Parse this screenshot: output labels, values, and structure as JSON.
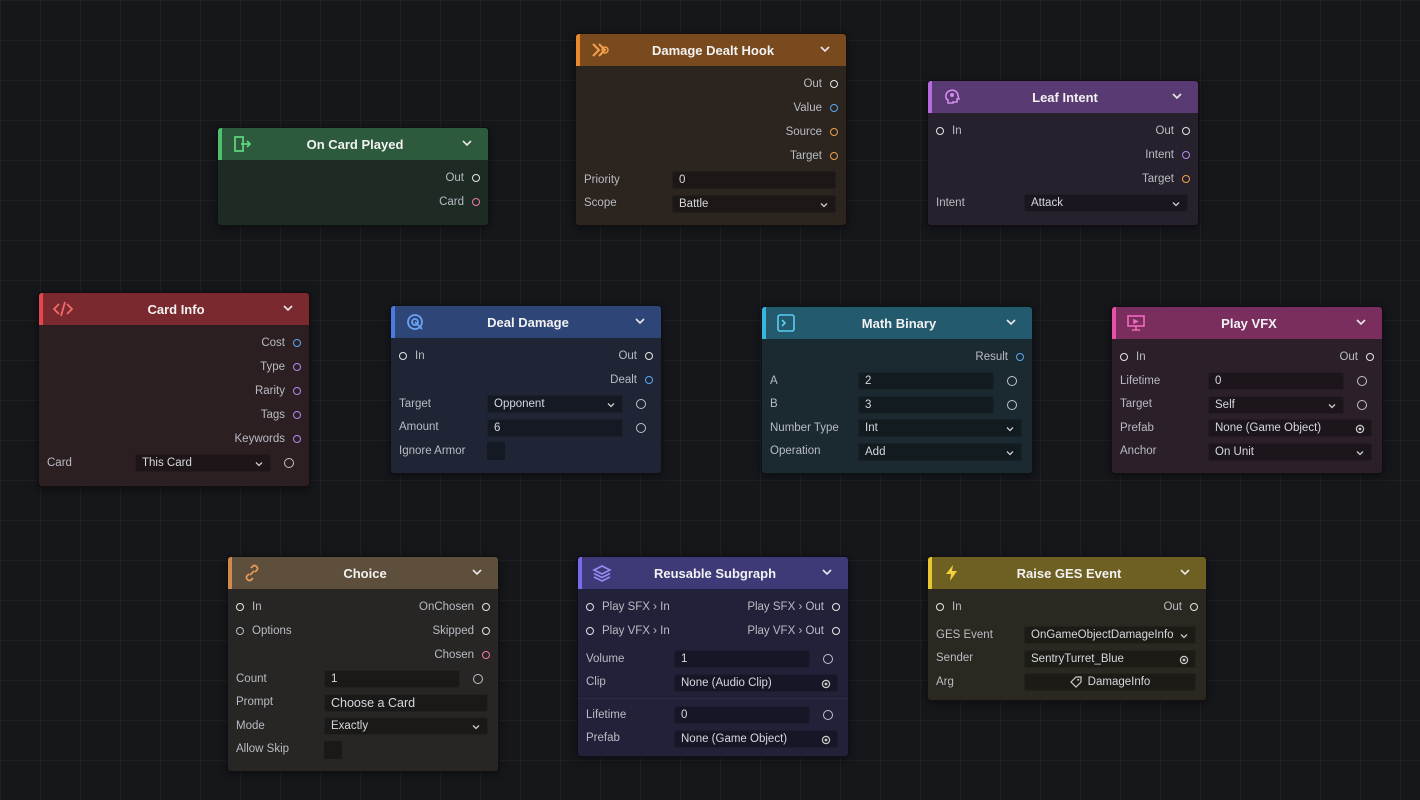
{
  "colors": {
    "canvas": "#15171b",
    "port_white": "#e6e6e6",
    "port_blue": "#5aa7f0",
    "port_purple": "#b58cf0",
    "port_orange": "#f0a04b",
    "port_pink": "#f07aa8"
  },
  "nodes": {
    "damage_hook": {
      "title": "Damage Dealt Hook",
      "icon": "hook-icon",
      "outputs": [
        "Out",
        "Value",
        "Source",
        "Target"
      ],
      "priority_label": "Priority",
      "priority_value": "0",
      "scope_label": "Scope",
      "scope_value": "Battle"
    },
    "leaf_intent": {
      "title": "Leaf Intent",
      "icon": "brain-icon",
      "in_label": "In",
      "outputs": [
        "Out",
        "Intent",
        "Target"
      ],
      "intent_label": "Intent",
      "intent_value": "Attack"
    },
    "card_played": {
      "title": "On Card Played",
      "icon": "exit-door-icon",
      "outputs": [
        "Out",
        "Card"
      ]
    },
    "card_info": {
      "title": "Card Info",
      "icon": "code-icon",
      "outputs": [
        "Cost",
        "Type",
        "Rarity",
        "Tags",
        "Keywords"
      ],
      "card_label": "Card",
      "card_value": "This Card"
    },
    "deal_damage": {
      "title": "Deal Damage",
      "icon": "target-icon",
      "in_label": "In",
      "outputs": [
        "Out",
        "Dealt"
      ],
      "target_label": "Target",
      "target_value": "Opponent",
      "amount_label": "Amount",
      "amount_value": "6",
      "ignore_armor_label": "Ignore Armor"
    },
    "math_binary": {
      "title": "Math Binary",
      "icon": "terminal-icon",
      "result_label": "Result",
      "a_label": "A",
      "a_value": "2",
      "b_label": "B",
      "b_value": "3",
      "number_type_label": "Number Type",
      "number_type_value": "Int",
      "operation_label": "Operation",
      "operation_value": "Add"
    },
    "play_vfx": {
      "title": "Play VFX",
      "icon": "presentation-icon",
      "in_label": "In",
      "out_label": "Out",
      "lifetime_label": "Lifetime",
      "lifetime_value": "0",
      "target_label": "Target",
      "target_value": "Self",
      "prefab_label": "Prefab",
      "prefab_value": "None (Game Object)",
      "anchor_label": "Anchor",
      "anchor_value": "On Unit"
    },
    "choice": {
      "title": "Choice",
      "icon": "link-icon",
      "in_label": "In",
      "options_label": "Options",
      "outputs": [
        "OnChosen",
        "Skipped",
        "Chosen"
      ],
      "count_label": "Count",
      "count_value": "1",
      "prompt_label": "Prompt",
      "prompt_value": "Choose a Card",
      "mode_label": "Mode",
      "mode_value": "Exactly",
      "allow_skip_label": "Allow Skip"
    },
    "subgraph": {
      "title": "Reusable Subgraph",
      "icon": "layers-icon",
      "sfx_in": "Play SFX › In",
      "sfx_out": "Play SFX › Out",
      "vfx_in": "Play VFX › In",
      "vfx_out": "Play VFX › Out",
      "volume_label": "Volume",
      "volume_value": "1",
      "clip_label": "Clip",
      "clip_value": "None (Audio Clip)",
      "lifetime_label": "Lifetime",
      "lifetime_value": "0",
      "prefab_label": "Prefab",
      "prefab_value": "None (Game Object)"
    },
    "ges_event": {
      "title": "Raise GES Event",
      "icon": "lightning-icon",
      "in_label": "In",
      "out_label": "Out",
      "event_label": "GES Event",
      "event_value": "OnGameObjectDamageInfo",
      "sender_label": "Sender",
      "sender_value": "SentryTurret_Blue",
      "arg_label": "Arg",
      "arg_value": "DamageInfo"
    }
  }
}
